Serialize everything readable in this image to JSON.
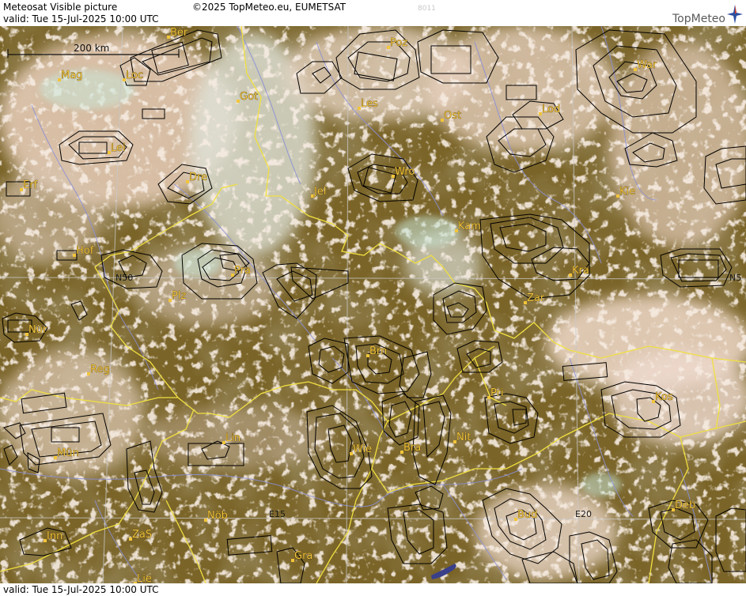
{
  "header": {
    "title": "Meteosat Visible picture",
    "valid": "valid:  Tue  15-Jul-2025  10:00 UTC",
    "copyright": "©2025 TopMeteo.eu, EUMETSAT",
    "code": "8011",
    "logo": "TopMeteo"
  },
  "footer": {
    "valid": "valid:  Tue  15-Jul-2025  10:00 UTC"
  },
  "scale": {
    "label": "200 km"
  },
  "grid_labels": {
    "n50_left": "N50",
    "n50_right": "N5",
    "e15": "E15",
    "e20": "E20"
  },
  "cities": [
    {
      "name": "Ber"
    },
    {
      "name": "Poz"
    },
    {
      "name": "War"
    },
    {
      "name": "Mag"
    },
    {
      "name": "Loc"
    },
    {
      "name": "Got"
    },
    {
      "name": "Les"
    },
    {
      "name": "Lod"
    },
    {
      "name": "Ost"
    },
    {
      "name": "Lei"
    },
    {
      "name": "Dre"
    },
    {
      "name": "Wro"
    },
    {
      "name": "Erf"
    },
    {
      "name": "Jel"
    },
    {
      "name": "Kie"
    },
    {
      "name": "Kam"
    },
    {
      "name": "Hof"
    },
    {
      "name": "Pra"
    },
    {
      "name": "Kra"
    },
    {
      "name": "Plz"
    },
    {
      "name": "Zar"
    },
    {
      "name": "Nür"
    },
    {
      "name": "Brn"
    },
    {
      "name": "Reg"
    },
    {
      "name": "Pri"
    },
    {
      "name": "Kos"
    },
    {
      "name": "Lin"
    },
    {
      "name": "Nit"
    },
    {
      "name": "Mün"
    },
    {
      "name": "Wie"
    },
    {
      "name": "Bra"
    },
    {
      "name": "Inn"
    },
    {
      "name": "ZaS"
    },
    {
      "name": "Nöb"
    },
    {
      "name": "Bud"
    },
    {
      "name": "Deb"
    },
    {
      "name": "Gra"
    },
    {
      "name": "Lie"
    }
  ],
  "colors": {
    "land": "#7a6428",
    "cloud": "#ecd5c3",
    "border": "#f0e040",
    "rivers": "#8a8ed8",
    "grid": "#c8c8c8",
    "label": "#f2c53a"
  }
}
